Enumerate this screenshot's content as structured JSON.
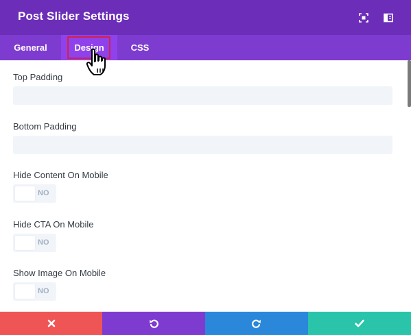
{
  "window": {
    "title": "Post Slider Settings"
  },
  "header_icons": [
    "fullscreen-icon",
    "sidebar-icon"
  ],
  "tabs": [
    {
      "label": "General",
      "active": false
    },
    {
      "label": "Design",
      "active": true
    },
    {
      "label": "CSS",
      "active": false
    }
  ],
  "fields": {
    "top_padding": {
      "label": "Top Padding",
      "value": ""
    },
    "bottom_padding": {
      "label": "Bottom Padding",
      "value": ""
    }
  },
  "toggles": [
    {
      "label": "Hide Content On Mobile",
      "state": "NO"
    },
    {
      "label": "Hide CTA On Mobile",
      "state": "NO"
    },
    {
      "label": "Show Image On Mobile",
      "state": "NO"
    }
  ],
  "footer": {
    "cancel_icon": "close-icon",
    "undo_icon": "undo-icon",
    "redo_icon": "redo-icon",
    "save_icon": "check-icon"
  },
  "colors": {
    "header": "#6c2eb9",
    "tabs": "#7e3bd0",
    "active_tab": "#8f42ec",
    "cancel": "#ef5555",
    "undo": "#7e3bd0",
    "redo": "#2b87da",
    "save": "#29c4a9",
    "highlight": "#d1224a"
  }
}
